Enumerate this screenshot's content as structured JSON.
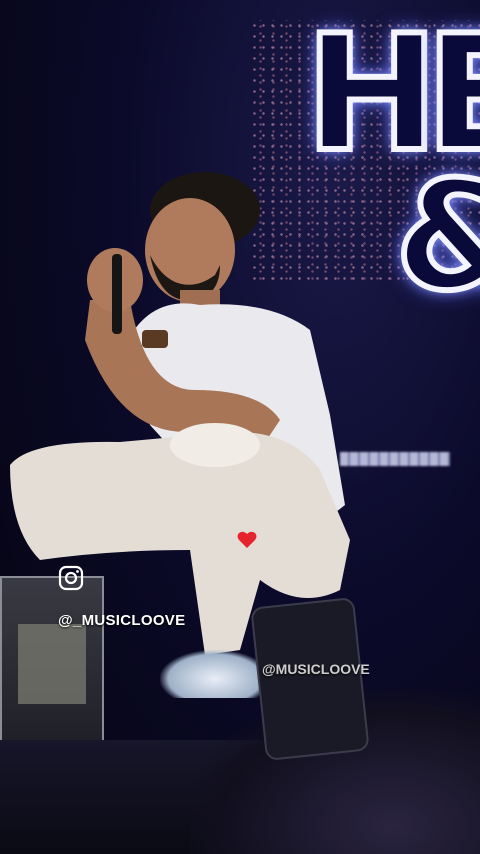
{
  "overlay": {
    "handle_left": "@_MUSICLOOVE",
    "handle_right": "@MUSICLOOVE"
  },
  "backdrop": {
    "sign_letters": [
      "H",
      "E",
      "&"
    ]
  },
  "icons": {
    "instagram": "instagram-icon",
    "heart": "heart-icon"
  },
  "colors": {
    "background": "#0b0a2a",
    "neon": "#f4f4ff",
    "heart": "#e5242b",
    "shirt": "#e9e9ee",
    "skin": "#b07a5c"
  }
}
